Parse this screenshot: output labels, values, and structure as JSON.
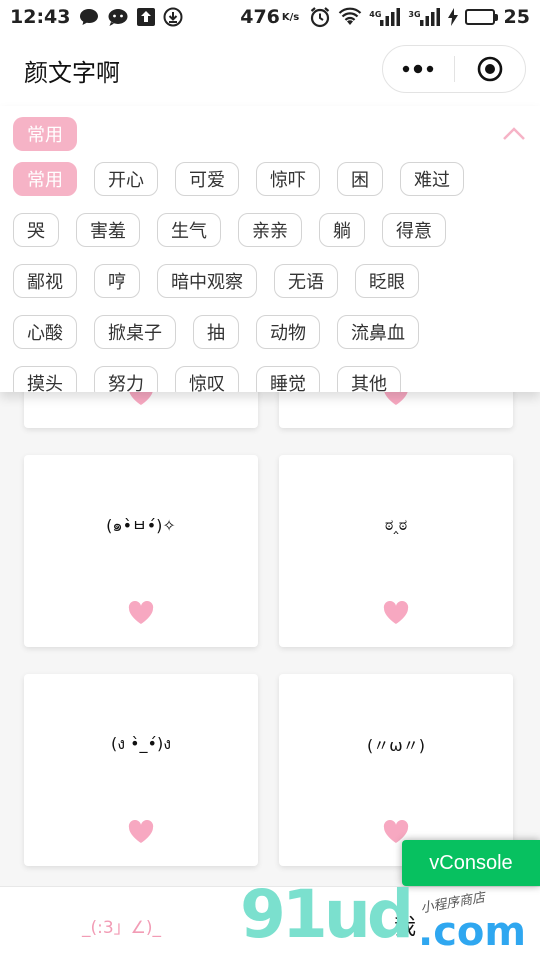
{
  "status_bar": {
    "time": "12:43",
    "speed": "476",
    "speed_unit": "K/s",
    "net_tag_1": "4G",
    "net_tag_2": "3G",
    "battery_level": "25",
    "battery_fill": 0.25,
    "icons": [
      "chat-bubble-icon",
      "messenger-icon",
      "upload-icon",
      "download-icon",
      "alarm-icon",
      "wifi-icon",
      "signal-icon",
      "charging-icon",
      "battery-icon"
    ]
  },
  "nav": {
    "title": "颜文字啊"
  },
  "tag_panel": {
    "current": "常用",
    "rows": [
      [
        "常用",
        "开心",
        "可爱",
        "惊吓",
        "困",
        "难过"
      ],
      [
        "哭",
        "害羞",
        "生气",
        "亲亲",
        "躺",
        "得意"
      ],
      [
        "鄙视",
        "哼",
        "暗中观察",
        "无语",
        "眨眼"
      ],
      [
        "心酸",
        "掀桌子",
        "抽",
        "动物",
        "流鼻血"
      ],
      [
        "摸头",
        "努力",
        "惊叹",
        "睡觉",
        "其他"
      ]
    ]
  },
  "cards": [
    {
      "face": "",
      "favorited": true
    },
    {
      "face": "",
      "favorited": true
    },
    {
      "face": "(๑•̀ㅂ•́)✧",
      "favorited": true
    },
    {
      "face": "ಠ‸ಠ",
      "favorited": true
    },
    {
      "face": "(ง •̀_•́)ง",
      "favorited": true
    },
    {
      "face": "(〃ω〃)",
      "favorited": true
    }
  ],
  "tab_bar": {
    "home": "_(:3」∠)_",
    "me": "我"
  },
  "overlays": {
    "vconsole": "vConsole",
    "watermark_logo": "91ud",
    "watermark_com": ".com",
    "watermark_sub": "小程序商店"
  },
  "colors": {
    "accent_pink": "#f6b3c6",
    "heart_pink": "#f7a8c1",
    "vconsole_green": "#07c160"
  }
}
